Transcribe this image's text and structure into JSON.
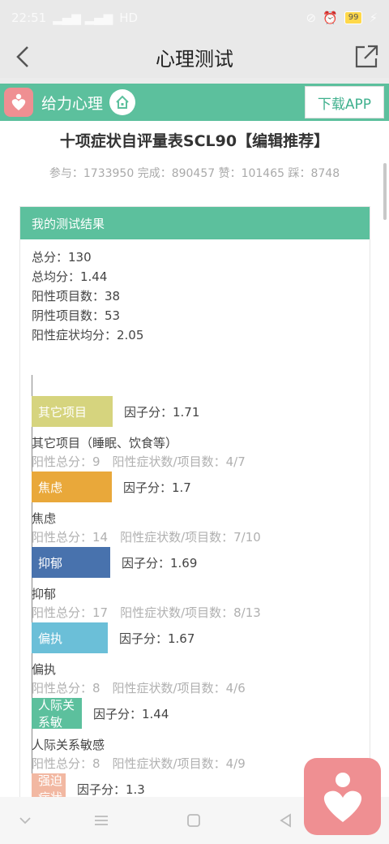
{
  "status_bar": {
    "time": "22:51",
    "signal": "HD",
    "battery": "99"
  },
  "nav": {
    "title": "心理测试"
  },
  "brand": {
    "name": "给力心理",
    "download_label": "下载APP"
  },
  "test": {
    "title": "十项症状自评量表SCL90【编辑推荐】",
    "stats": "参与：1733950 完成：890457 赞：101465 踩：8748"
  },
  "result": {
    "header": "我的测试结果",
    "summary": [
      "总分：130",
      "总均分：1.44",
      "阳性项目数：38",
      "阴性项目数：53",
      "阳性症状均分：2.05"
    ]
  },
  "chart_data": {
    "type": "bar",
    "orientation": "horizontal",
    "categories": [
      "其它项目",
      "焦虑",
      "抑郁",
      "偏执",
      "人际关系敏",
      "强迫症状"
    ],
    "values": [
      1.71,
      1.7,
      1.69,
      1.67,
      1.44,
      1.3
    ],
    "colors": [
      "#d6d47e",
      "#e9a83a",
      "#4872ad",
      "#6bbfd8",
      "#5cc09d",
      "#f2b8a2"
    ]
  },
  "factors": [
    {
      "bar_label": "其它项目",
      "score": "因子分：1.71",
      "name": "其它项目（睡眠、饮食等）",
      "stats": "阳性总分：9　阳性症状数/项目数：4/7"
    },
    {
      "bar_label": "焦虑",
      "score": "因子分：1.7",
      "name": "焦虑",
      "stats": "阳性总分：14　阳性症状数/项目数：7/10"
    },
    {
      "bar_label": "抑郁",
      "score": "因子分：1.69",
      "name": "抑郁",
      "stats": "阳性总分：17　阳性症状数/项目数：8/13"
    },
    {
      "bar_label": "偏执",
      "score": "因子分：1.67",
      "name": "偏执",
      "stats": "阳性总分：8　阳性症状数/项目数：4/6"
    },
    {
      "bar_label": "人际关系敏",
      "score": "因子分：1.44",
      "name": "人际关系敏感",
      "stats": "阳性总分：8　阳性症状数/项目数：4/9"
    },
    {
      "bar_label": "强迫症状",
      "score": "因子分：1.3",
      "name": "",
      "stats": ""
    }
  ],
  "icons": {
    "back": "chevron-left-icon",
    "share": "share-icon",
    "home": "home-icon",
    "brand": "heart-person-icon"
  }
}
